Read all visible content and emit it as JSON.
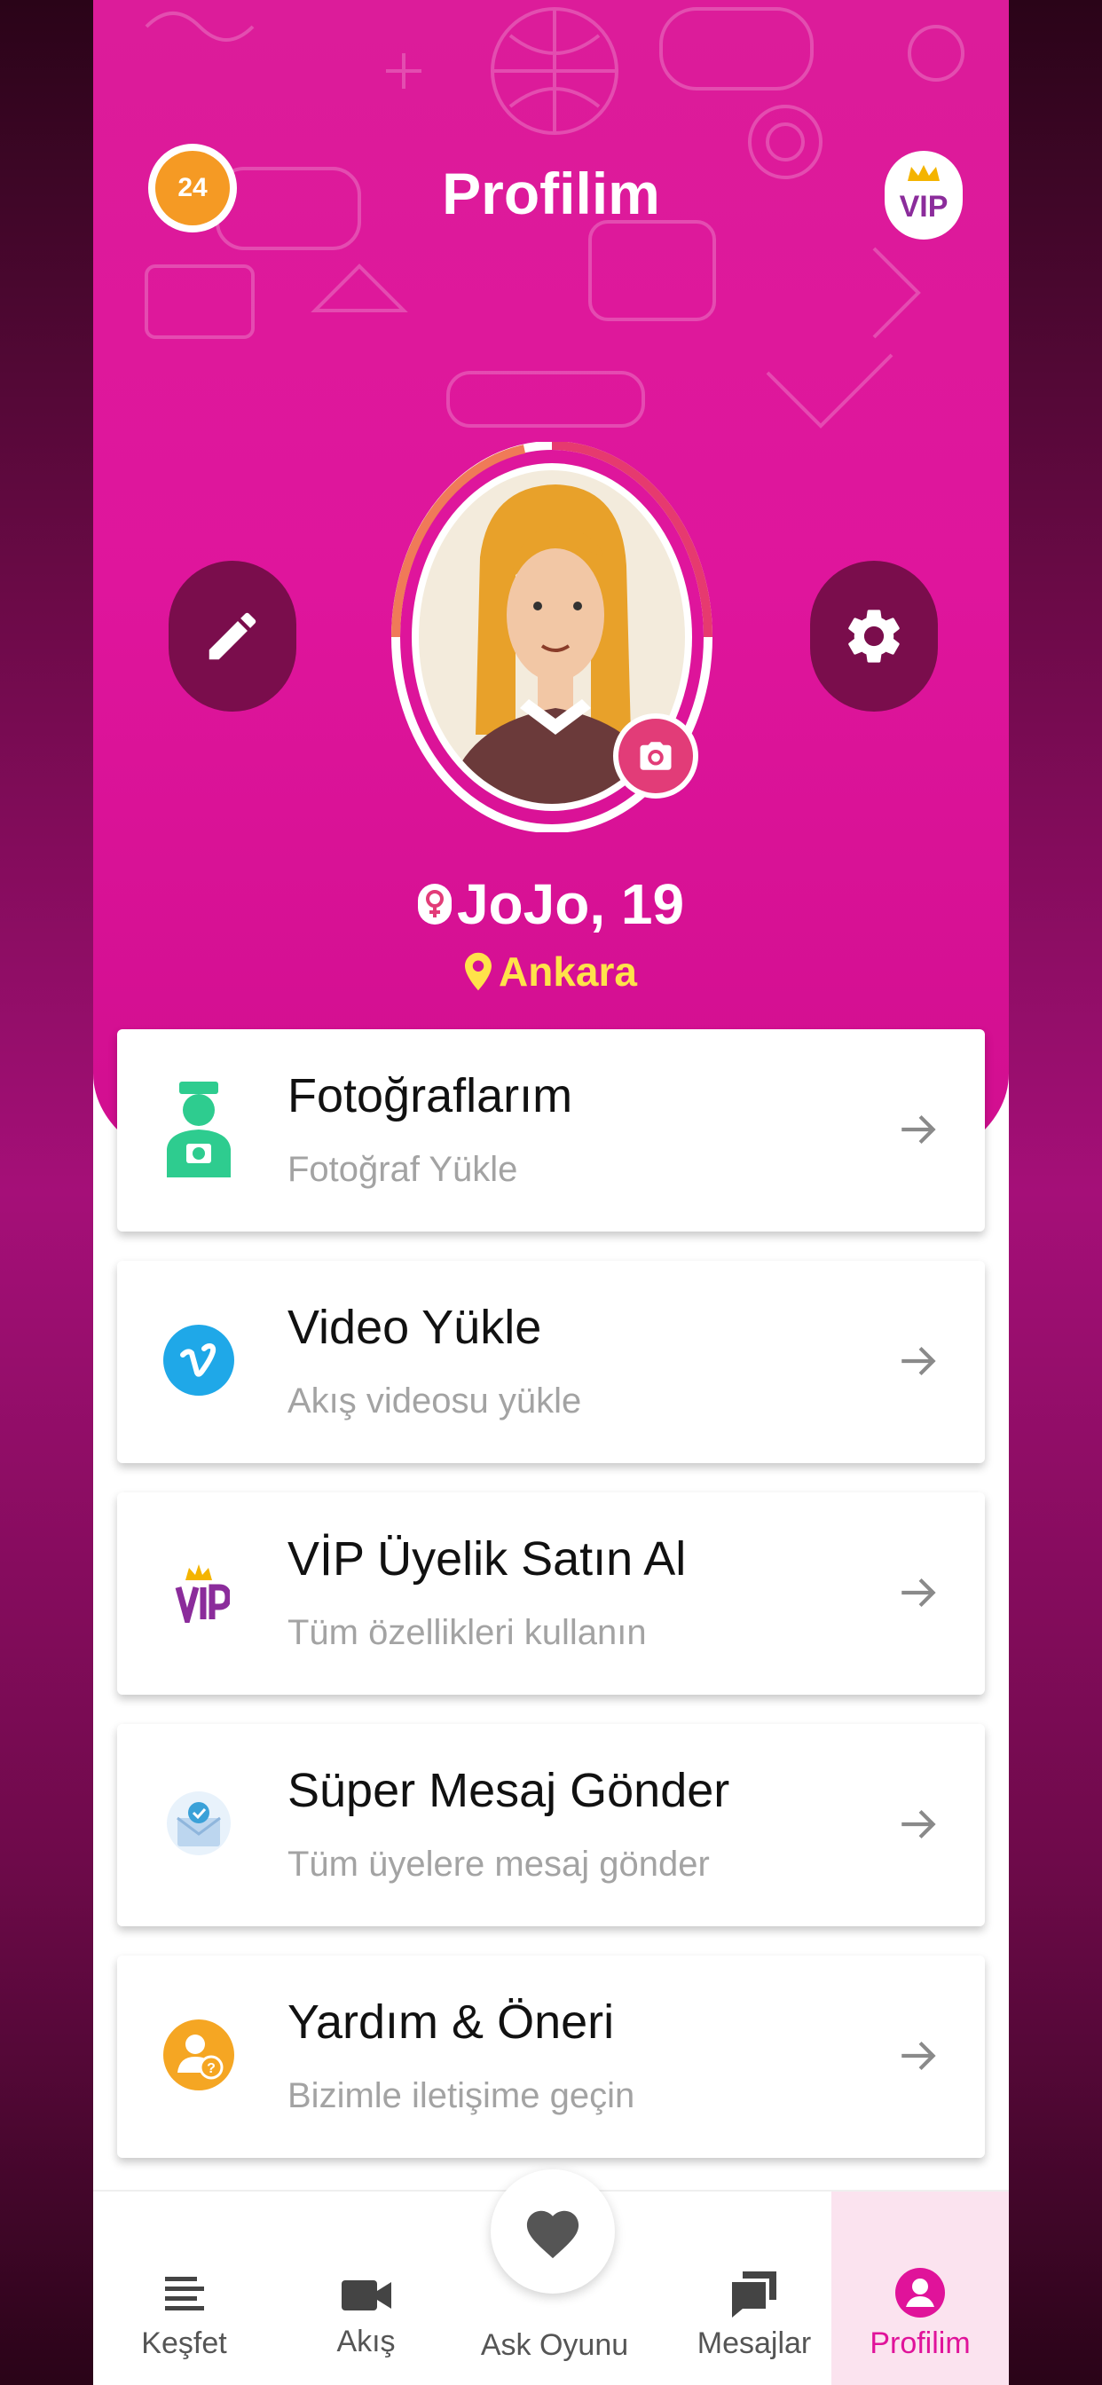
{
  "header": {
    "title": "Profilim",
    "notification_count": "24",
    "vip_label": "VIP"
  },
  "profile": {
    "name_age": "JoJo, 19",
    "city": "Ankara",
    "gender": "female"
  },
  "menu": [
    {
      "title": "Fotoğraflarım",
      "subtitle": "Fotoğraf Yükle",
      "icon": "photographer-icon"
    },
    {
      "title": "Video Yükle",
      "subtitle": "Akış videosu yükle",
      "icon": "vimeo-icon"
    },
    {
      "title": "VİP Üyelik Satın Al",
      "subtitle": "Tüm özellikleri kullanın",
      "icon": "vip-crown-icon"
    },
    {
      "title": "Süper Mesaj Gönder",
      "subtitle": "Tüm üyelere mesaj gönder",
      "icon": "super-message-icon"
    },
    {
      "title": "Yardım & Öneri",
      "subtitle": "Bizimle iletişime geçin",
      "icon": "help-user-icon"
    }
  ],
  "tabs": [
    {
      "label": "Keşfet",
      "icon": "list-icon"
    },
    {
      "label": "Akış",
      "icon": "video-camera-icon"
    },
    {
      "label": "Ask Oyunu",
      "icon": "heart-icon"
    },
    {
      "label": "Mesajlar",
      "icon": "messages-icon"
    },
    {
      "label": "Profilim",
      "icon": "profile-icon",
      "active": true
    }
  ],
  "colors": {
    "primary": "#e0139a",
    "dark_button": "#7a0d4c",
    "city_yellow": "#ffe24a",
    "notification_orange": "#f59a24"
  }
}
